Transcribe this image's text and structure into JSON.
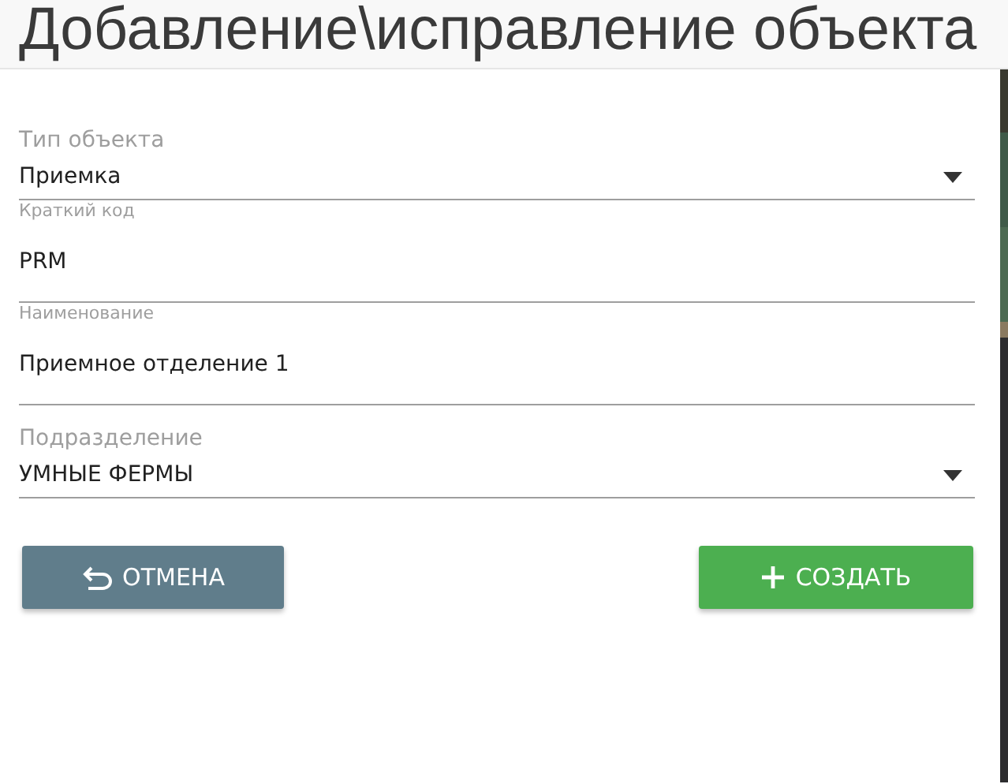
{
  "title": "Добавление\\исправление объекта",
  "fields": [
    {
      "kind": "select",
      "label": "Тип объекта",
      "value": "Приемка"
    },
    {
      "kind": "text",
      "label": "Краткий код",
      "value": "PRM"
    },
    {
      "kind": "text",
      "label": "Наименование",
      "value": "Приемное отделение 1"
    },
    {
      "kind": "select",
      "label": "Подразделение",
      "value": "УМНЫЕ ФЕРМЫ"
    }
  ],
  "buttons": [
    {
      "kind": "cancel",
      "label": "ОТМЕНА"
    },
    {
      "kind": "create",
      "label": "СОЗДАТЬ"
    }
  ]
}
